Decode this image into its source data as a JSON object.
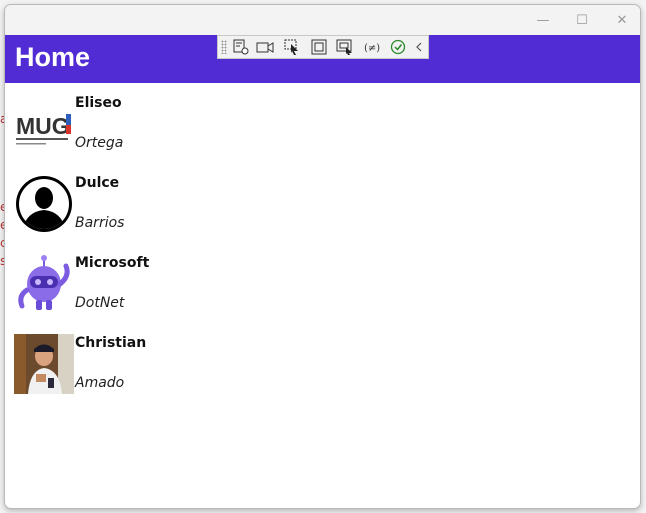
{
  "window": {
    "minimize_glyph": "—",
    "maximize_glyph": "☐",
    "close_glyph": "✕"
  },
  "app": {
    "title": "Home",
    "accent": "#512bd4"
  },
  "toolbar_icons": [
    "select-element-icon",
    "camera-icon",
    "pointer-icon",
    "frame-icon",
    "layout-select-icon",
    "binding-icon",
    "check-icon",
    "collapse-icon"
  ],
  "contacts": [
    {
      "first": "Eliseo",
      "last": "Ortega",
      "avatar": "mug-logo"
    },
    {
      "first": "Dulce",
      "last": "Barrios",
      "avatar": "person-silhouette"
    },
    {
      "first": "Microsoft",
      "last": "DotNet",
      "avatar": "dotnet-bot"
    },
    {
      "first": "Christian",
      "last": "Amado",
      "avatar": "photo"
    }
  ]
}
